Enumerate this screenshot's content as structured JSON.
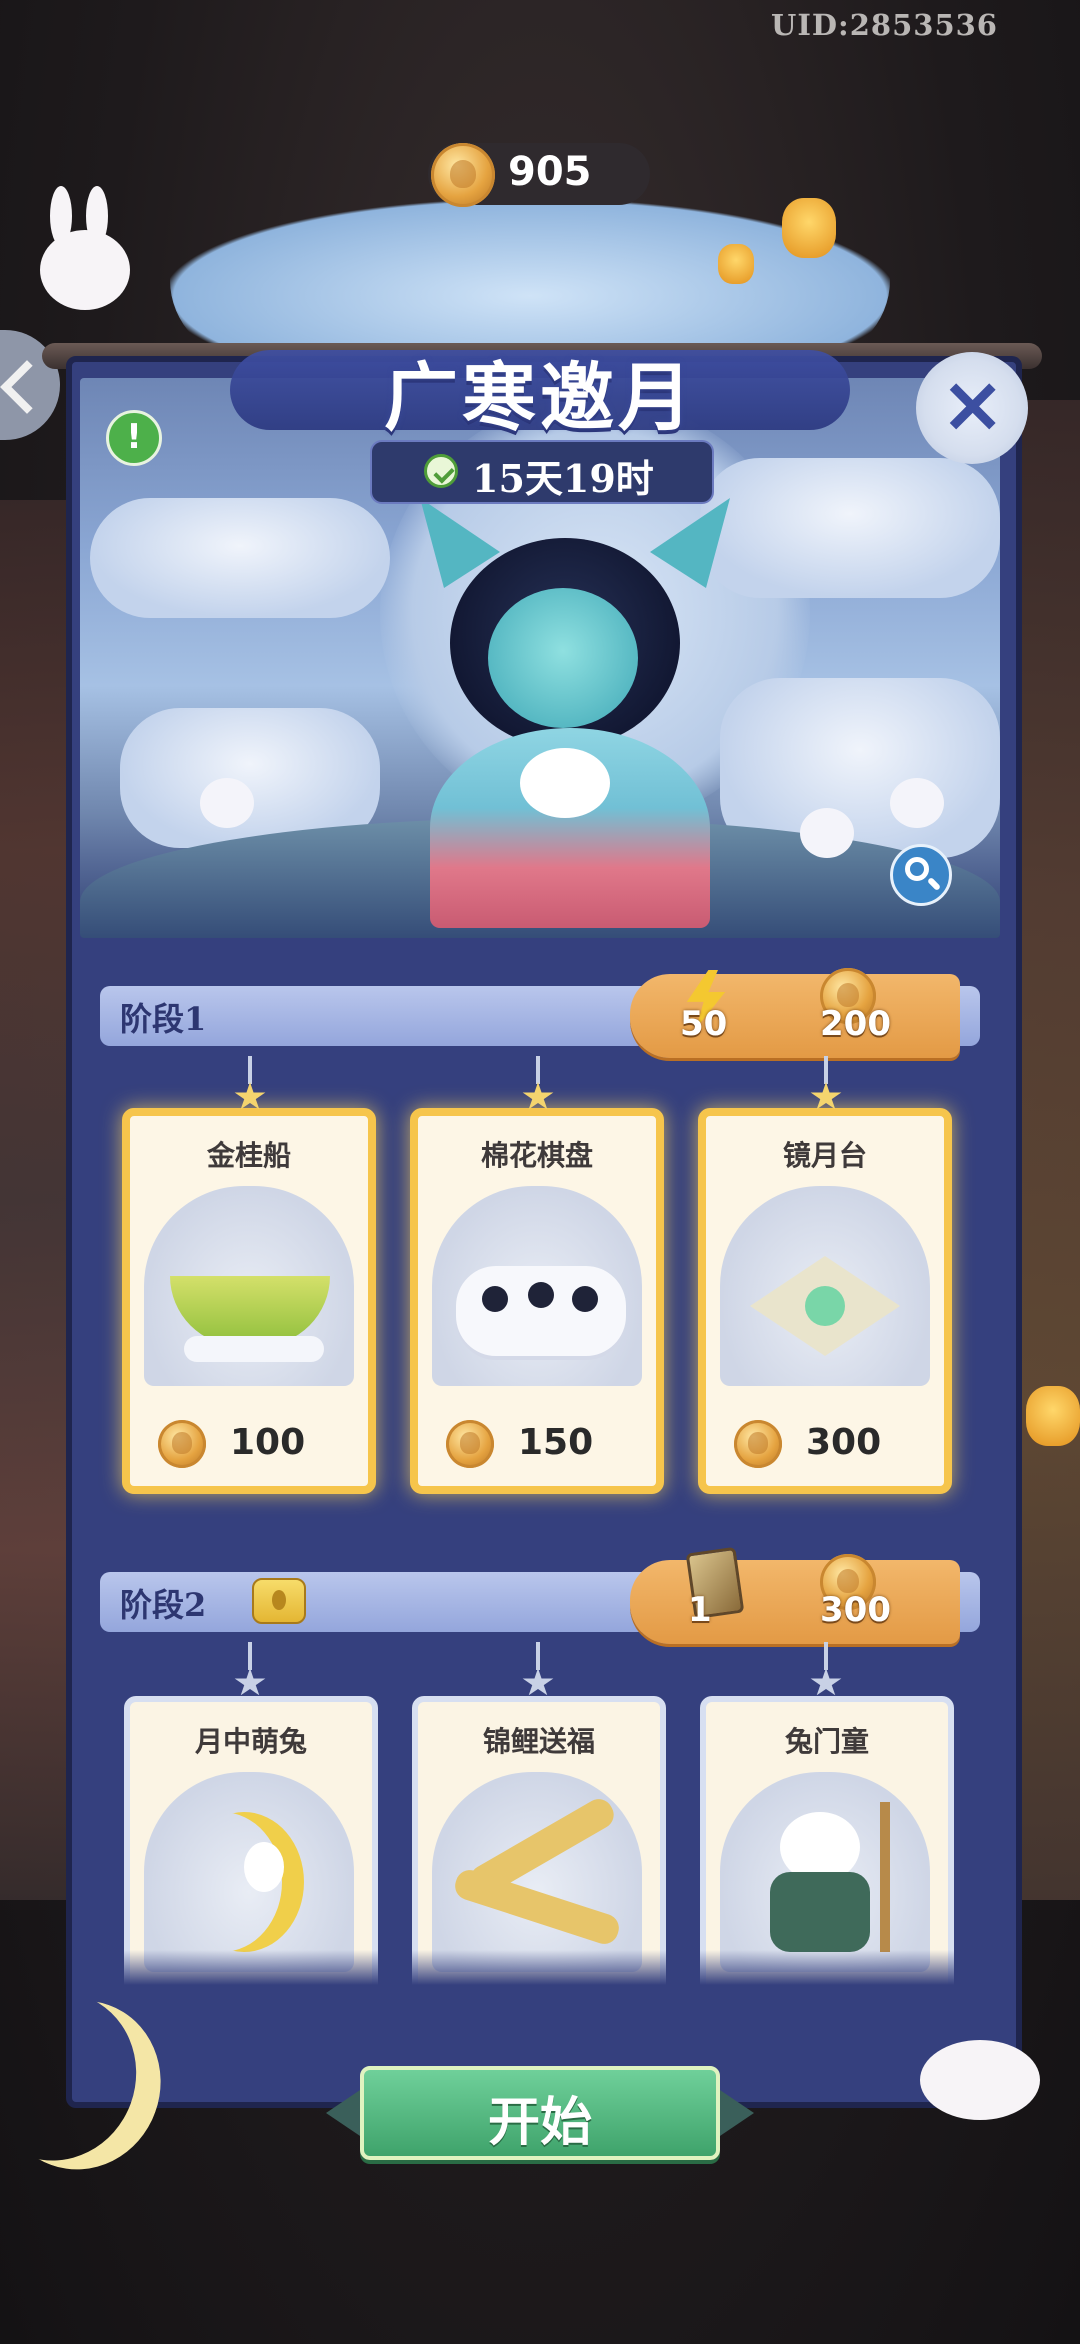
{
  "uid": "UID:2853536",
  "currency": {
    "icon": "mooncake-coin-icon",
    "amount": "905"
  },
  "event": {
    "title": "广寒邀月",
    "timer": "15天19时"
  },
  "stages": [
    {
      "label": "阶段1",
      "reward": {
        "energy": "50",
        "coins": "200"
      },
      "items": [
        {
          "name": "金桂船",
          "cost": "100"
        },
        {
          "name": "棉花棋盘",
          "cost": "150"
        },
        {
          "name": "镜月台",
          "cost": "300"
        }
      ]
    },
    {
      "label": "阶段2",
      "reward": {
        "cards": "1",
        "coins": "300"
      },
      "items": [
        {
          "name": "月中萌兔"
        },
        {
          "name": "锦鲤送福"
        },
        {
          "name": "兔门童"
        }
      ]
    }
  ],
  "start_button": "开始",
  "colors": {
    "panel": "#35407e",
    "accent_gold": "#f6c54c",
    "reward_orange": "#e39a45",
    "start_green": "#3fa36b"
  }
}
